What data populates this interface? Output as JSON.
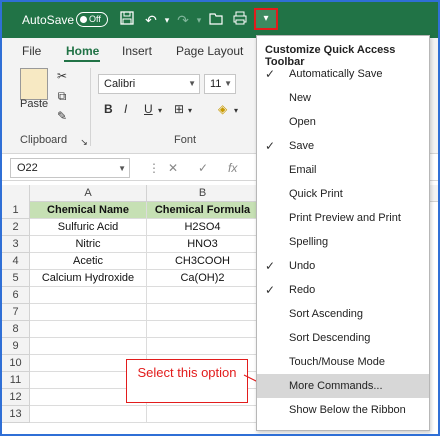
{
  "titlebar": {
    "autosave_label": "AutoSave",
    "autosave_state": "Off",
    "icons": [
      "save-icon",
      "undo-icon",
      "redo-icon",
      "open-icon",
      "print-icon",
      "customize-qat-icon"
    ]
  },
  "ribbon": {
    "tabs": [
      "File",
      "Home",
      "Insert",
      "Page Layout"
    ],
    "active_tab": "Home",
    "clipboard": {
      "paste_label": "Paste",
      "group_label": "Clipboard"
    },
    "font": {
      "name": "Calibri",
      "size": "11",
      "bold": "B",
      "italic": "I",
      "underline": "U",
      "group_label": "Font"
    }
  },
  "formula_bar": {
    "name_box": "O22",
    "fx": "fx",
    "cancel": "✕",
    "enter": "✓"
  },
  "grid": {
    "columns": [
      "A",
      "B"
    ],
    "rows": [
      "1",
      "2",
      "3",
      "4",
      "5",
      "6",
      "7",
      "8",
      "9",
      "10",
      "11",
      "12",
      "13"
    ],
    "table": [
      [
        "Chemical Name",
        "Chemical Formula"
      ],
      [
        "Sulfuric Acid",
        "H2SO4"
      ],
      [
        "Nitric",
        "HNO3"
      ],
      [
        "Acetic",
        "CH3COOH"
      ],
      [
        "Calcium Hydroxide",
        "Ca(OH)2"
      ]
    ]
  },
  "callout": {
    "text": "Select this option"
  },
  "menu": {
    "title": "Customize Quick Access Toolbar",
    "items": [
      {
        "label": "Automatically Save",
        "checked": true
      },
      {
        "label": "New",
        "checked": false
      },
      {
        "label": "Open",
        "checked": false
      },
      {
        "label": "Save",
        "checked": true
      },
      {
        "label": "Email",
        "checked": false
      },
      {
        "label": "Quick Print",
        "checked": false
      },
      {
        "label": "Print Preview and Print",
        "checked": false
      },
      {
        "label": "Spelling",
        "checked": false
      },
      {
        "label": "Undo",
        "checked": true
      },
      {
        "label": "Redo",
        "checked": true
      },
      {
        "label": "Sort Ascending",
        "checked": false
      },
      {
        "label": "Sort Descending",
        "checked": false
      },
      {
        "label": "Touch/Mouse Mode",
        "checked": false
      },
      {
        "label": "More Commands...",
        "checked": false,
        "highlighted": true
      },
      {
        "label": "Show Below the Ribbon",
        "checked": false
      }
    ]
  },
  "colors": {
    "excel_green": "#217346",
    "header_fill": "#c6e0b4",
    "callout_red": "#e21c1c"
  }
}
